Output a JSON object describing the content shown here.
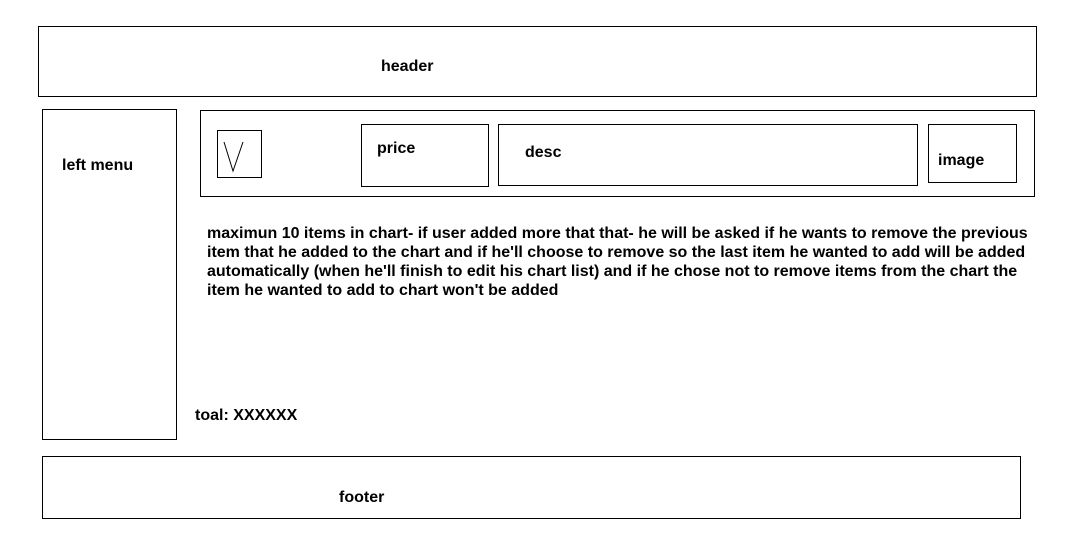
{
  "header": {
    "label": "header"
  },
  "left_menu": {
    "label": "left menu"
  },
  "item_row": {
    "checkbox_icon": "checkmark-icon",
    "price_label": "price",
    "desc_label": "desc",
    "image_label": "image"
  },
  "note": "maximun 10 items in chart- if user added more that that- he will be asked if he wants to remove the previous item that he added to the chart and if he'll choose to remove so the last item he wanted to add will be added automatically (when he'll finish to edit his chart list) and if he chose not to remove items from the chart the item he wanted to add to chart won't be added",
  "total": "toal: XXXXXX",
  "footer": {
    "label": "footer"
  }
}
